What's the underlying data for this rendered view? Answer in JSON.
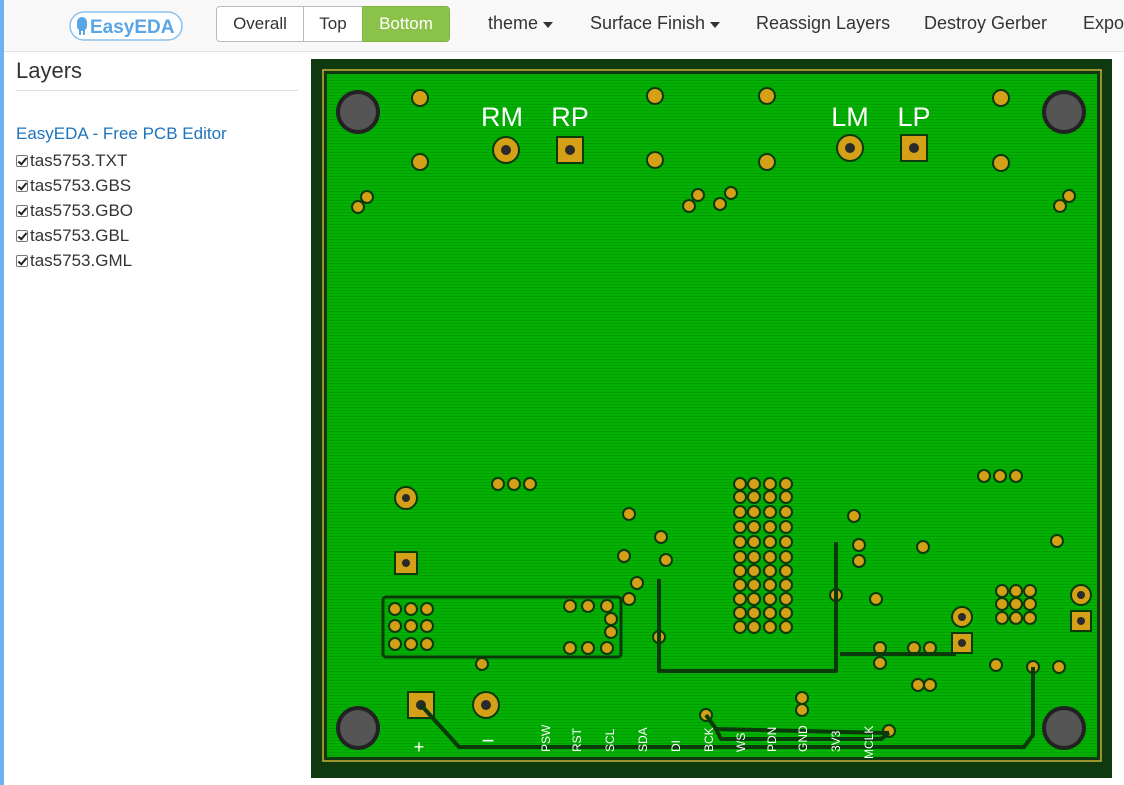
{
  "app": {
    "logo_text": "EasyEDA"
  },
  "view_toggle": {
    "buttons": [
      {
        "label": "Overall",
        "active": false
      },
      {
        "label": "Top",
        "active": false
      },
      {
        "label": "Bottom",
        "active": true
      }
    ]
  },
  "menu": {
    "items": [
      {
        "label": "theme",
        "dropdown": true
      },
      {
        "label": "Surface Finish",
        "dropdown": true
      },
      {
        "label": "Reassign Layers",
        "dropdown": false
      },
      {
        "label": "Destroy Gerber",
        "dropdown": false
      },
      {
        "label": "Expo",
        "dropdown": false
      }
    ]
  },
  "sidebar": {
    "title": "Layers",
    "link": "EasyEDA - Free PCB Editor",
    "layers": [
      {
        "name": "tas5753.TXT",
        "checked": true
      },
      {
        "name": "tas5753.GBS",
        "checked": true
      },
      {
        "name": "tas5753.GBO",
        "checked": true
      },
      {
        "name": "tas5753.GBL",
        "checked": true
      },
      {
        "name": "tas5753.GML",
        "checked": true
      }
    ]
  },
  "pcb": {
    "side": "Bottom",
    "speaker_labels": [
      "RM",
      "RP",
      "LM",
      "LP"
    ],
    "power_labels": [
      "+",
      "−"
    ],
    "pin_labels": [
      "PSW",
      "RST",
      "SCL",
      "SDA",
      "DI",
      "BCK",
      "WS",
      "PDN",
      "GND",
      "3V3",
      "MCLK"
    ]
  },
  "colors": {
    "board_border": "#0f3a0f",
    "copper_fill": "#00aa00",
    "pad_gold": "#d4a017",
    "silkscreen": "#ffffff",
    "active_button": "#8bc34a",
    "link": "#1e73be"
  }
}
